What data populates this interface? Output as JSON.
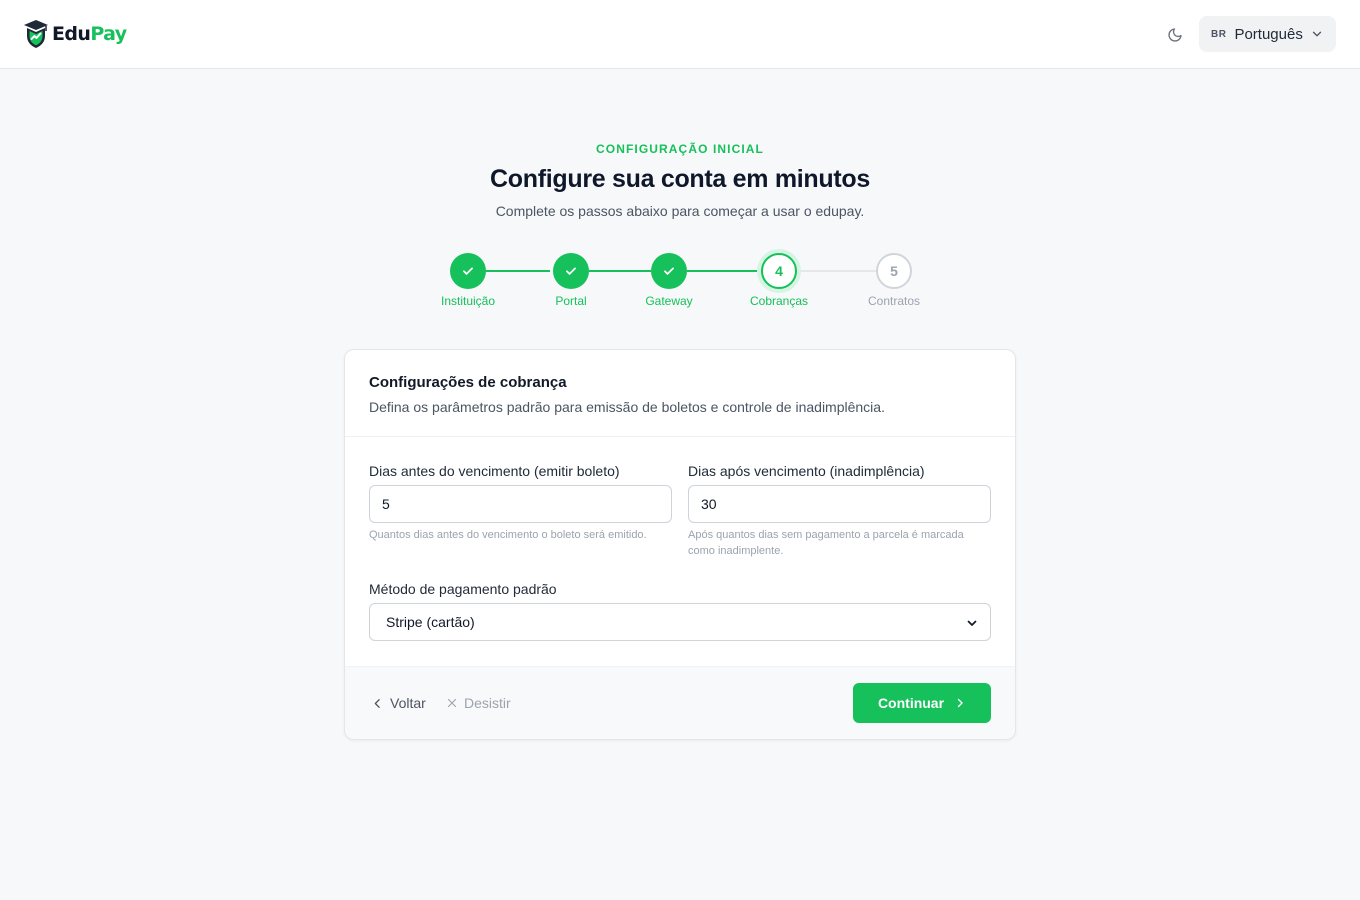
{
  "brand": {
    "name_part1": "Edu",
    "name_part2": "Pay",
    "accent_color": "#16c05a"
  },
  "header": {
    "theme_toggle_icon": "moon-icon",
    "language": {
      "code": "BR",
      "label": "Português",
      "icon": "chevron-down-icon"
    }
  },
  "hero": {
    "eyebrow": "CONFIGURAÇÃO INICIAL",
    "title": "Configure sua conta em minutos",
    "subtitle": "Complete os passos abaixo para começar a usar o edupay."
  },
  "steps": [
    {
      "label": "Instituição",
      "status": "done",
      "number": "1"
    },
    {
      "label": "Portal",
      "status": "done",
      "number": "2"
    },
    {
      "label": "Gateway",
      "status": "done",
      "number": "3"
    },
    {
      "label": "Cobranças",
      "status": "current",
      "number": "4"
    },
    {
      "label": "Contratos",
      "status": "todo",
      "number": "5"
    }
  ],
  "card": {
    "title": "Configurações de cobrança",
    "description": "Defina os parâmetros padrão para emissão de boletos e controle de inadimplência.",
    "fields": {
      "days_before": {
        "label": "Dias antes do vencimento (emitir boleto)",
        "value": "5",
        "hint": "Quantos dias antes do vencimento o boleto será emitido."
      },
      "days_after": {
        "label": "Dias após vencimento (inadimplência)",
        "value": "30",
        "hint": "Após quantos dias sem pagamento a parcela é marcada como inadimplente."
      },
      "payment_method": {
        "label": "Método de pagamento padrão",
        "value": "Stripe (cartão)"
      }
    },
    "footer": {
      "back_label": "Voltar",
      "quit_label": "Desistir",
      "continue_label": "Continuar"
    }
  }
}
